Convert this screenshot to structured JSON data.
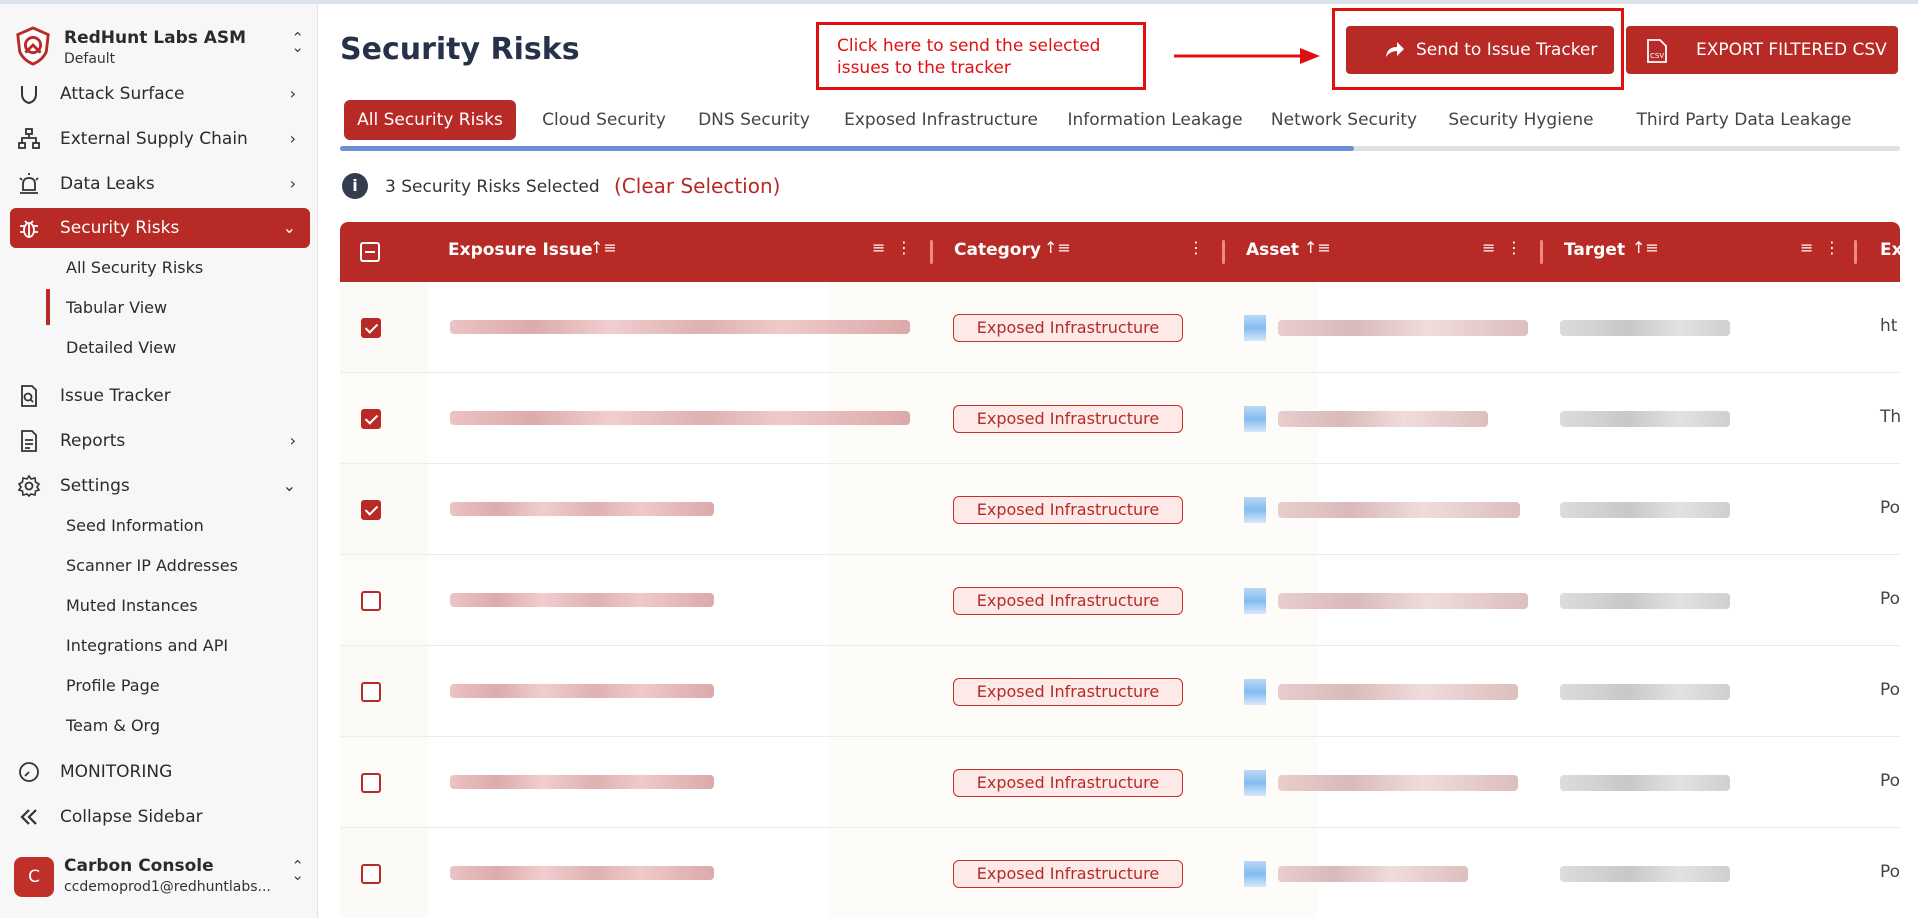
{
  "brand": {
    "name": "RedHunt Labs ASM",
    "workspace": "Default"
  },
  "sidebar": {
    "items": [
      {
        "label": "Attack Surface",
        "icon": "shield-icon"
      },
      {
        "label": "External Supply Chain",
        "icon": "sitemap-icon"
      },
      {
        "label": "Data Leaks",
        "icon": "siren-icon"
      },
      {
        "label": "Security Risks",
        "icon": "bug-icon",
        "active": true
      },
      {
        "label": "Issue Tracker",
        "icon": "doc-search-icon"
      },
      {
        "label": "Reports",
        "icon": "report-icon"
      },
      {
        "label": "Settings",
        "icon": "gear-icon"
      },
      {
        "label": "MONITORING",
        "icon": "clock-icon"
      },
      {
        "label": "Collapse Sidebar",
        "icon": "double-chevron-left-icon"
      }
    ],
    "security_sub": [
      "All Security Risks",
      "Tabular View",
      "Detailed View"
    ],
    "settings_sub": [
      "Seed Information",
      "Scanner IP Addresses",
      "Muted Instances",
      "Integrations and API",
      "Profile Page",
      "Team & Org"
    ]
  },
  "user": {
    "initial": "C",
    "name": "Carbon Console",
    "email": "ccdemoprod1@redhuntlabs..."
  },
  "page": {
    "title": "Security Risks"
  },
  "annotation": {
    "text": "Click here to send the selected issues to the tracker"
  },
  "actions": {
    "send_label": "Send to Issue Tracker",
    "export_label": "EXPORT FILTERED CSV",
    "export_badge": "CSV"
  },
  "tabs": [
    "All Security Risks",
    "Cloud Security",
    "DNS Security",
    "Exposed Infrastructure",
    "Information Leakage",
    "Network Security",
    "Security Hygiene",
    "Third Party Data Leakage"
  ],
  "tab_scroll_fraction": 0.65,
  "selection": {
    "count_text": "3 Security Risks Selected",
    "clear_label": "(Clear Selection)"
  },
  "table": {
    "columns": [
      "Exposure Issue",
      "Category",
      "Asset",
      "Target",
      "Ex"
    ],
    "rows": [
      {
        "checked": true,
        "category": "Exposed Infrastructure",
        "extra": "ht"
      },
      {
        "checked": true,
        "category": "Exposed Infrastructure",
        "extra": "Th"
      },
      {
        "checked": true,
        "category": "Exposed Infrastructure",
        "extra": "Po"
      },
      {
        "checked": false,
        "category": "Exposed Infrastructure",
        "extra": "Po"
      },
      {
        "checked": false,
        "category": "Exposed Infrastructure",
        "extra": "Po"
      },
      {
        "checked": false,
        "category": "Exposed Infrastructure",
        "extra": "Po"
      },
      {
        "checked": false,
        "category": "Exposed Infrastructure",
        "extra": "Po"
      }
    ]
  },
  "colors": {
    "brand": "#b72a25",
    "annotation": "#e01010",
    "tab_progress": "#6d8fd8"
  }
}
